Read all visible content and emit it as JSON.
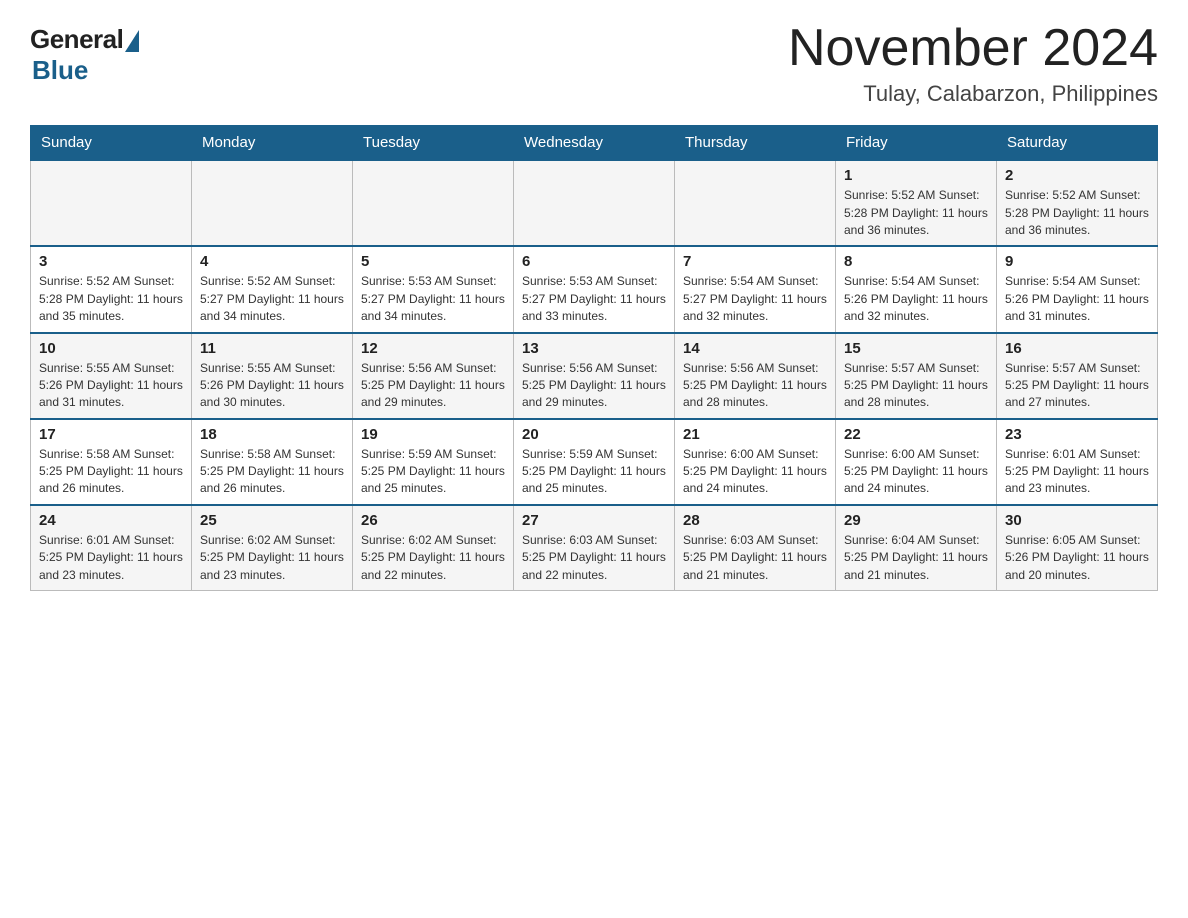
{
  "logo": {
    "general": "General",
    "blue": "Blue"
  },
  "title": "November 2024",
  "subtitle": "Tulay, Calabarzon, Philippines",
  "days_of_week": [
    "Sunday",
    "Monday",
    "Tuesday",
    "Wednesday",
    "Thursday",
    "Friday",
    "Saturday"
  ],
  "weeks": [
    {
      "days": [
        {
          "num": "",
          "info": ""
        },
        {
          "num": "",
          "info": ""
        },
        {
          "num": "",
          "info": ""
        },
        {
          "num": "",
          "info": ""
        },
        {
          "num": "",
          "info": ""
        },
        {
          "num": "1",
          "info": "Sunrise: 5:52 AM\nSunset: 5:28 PM\nDaylight: 11 hours and 36 minutes."
        },
        {
          "num": "2",
          "info": "Sunrise: 5:52 AM\nSunset: 5:28 PM\nDaylight: 11 hours and 36 minutes."
        }
      ]
    },
    {
      "days": [
        {
          "num": "3",
          "info": "Sunrise: 5:52 AM\nSunset: 5:28 PM\nDaylight: 11 hours and 35 minutes."
        },
        {
          "num": "4",
          "info": "Sunrise: 5:52 AM\nSunset: 5:27 PM\nDaylight: 11 hours and 34 minutes."
        },
        {
          "num": "5",
          "info": "Sunrise: 5:53 AM\nSunset: 5:27 PM\nDaylight: 11 hours and 34 minutes."
        },
        {
          "num": "6",
          "info": "Sunrise: 5:53 AM\nSunset: 5:27 PM\nDaylight: 11 hours and 33 minutes."
        },
        {
          "num": "7",
          "info": "Sunrise: 5:54 AM\nSunset: 5:27 PM\nDaylight: 11 hours and 32 minutes."
        },
        {
          "num": "8",
          "info": "Sunrise: 5:54 AM\nSunset: 5:26 PM\nDaylight: 11 hours and 32 minutes."
        },
        {
          "num": "9",
          "info": "Sunrise: 5:54 AM\nSunset: 5:26 PM\nDaylight: 11 hours and 31 minutes."
        }
      ]
    },
    {
      "days": [
        {
          "num": "10",
          "info": "Sunrise: 5:55 AM\nSunset: 5:26 PM\nDaylight: 11 hours and 31 minutes."
        },
        {
          "num": "11",
          "info": "Sunrise: 5:55 AM\nSunset: 5:26 PM\nDaylight: 11 hours and 30 minutes."
        },
        {
          "num": "12",
          "info": "Sunrise: 5:56 AM\nSunset: 5:25 PM\nDaylight: 11 hours and 29 minutes."
        },
        {
          "num": "13",
          "info": "Sunrise: 5:56 AM\nSunset: 5:25 PM\nDaylight: 11 hours and 29 minutes."
        },
        {
          "num": "14",
          "info": "Sunrise: 5:56 AM\nSunset: 5:25 PM\nDaylight: 11 hours and 28 minutes."
        },
        {
          "num": "15",
          "info": "Sunrise: 5:57 AM\nSunset: 5:25 PM\nDaylight: 11 hours and 28 minutes."
        },
        {
          "num": "16",
          "info": "Sunrise: 5:57 AM\nSunset: 5:25 PM\nDaylight: 11 hours and 27 minutes."
        }
      ]
    },
    {
      "days": [
        {
          "num": "17",
          "info": "Sunrise: 5:58 AM\nSunset: 5:25 PM\nDaylight: 11 hours and 26 minutes."
        },
        {
          "num": "18",
          "info": "Sunrise: 5:58 AM\nSunset: 5:25 PM\nDaylight: 11 hours and 26 minutes."
        },
        {
          "num": "19",
          "info": "Sunrise: 5:59 AM\nSunset: 5:25 PM\nDaylight: 11 hours and 25 minutes."
        },
        {
          "num": "20",
          "info": "Sunrise: 5:59 AM\nSunset: 5:25 PM\nDaylight: 11 hours and 25 minutes."
        },
        {
          "num": "21",
          "info": "Sunrise: 6:00 AM\nSunset: 5:25 PM\nDaylight: 11 hours and 24 minutes."
        },
        {
          "num": "22",
          "info": "Sunrise: 6:00 AM\nSunset: 5:25 PM\nDaylight: 11 hours and 24 minutes."
        },
        {
          "num": "23",
          "info": "Sunrise: 6:01 AM\nSunset: 5:25 PM\nDaylight: 11 hours and 23 minutes."
        }
      ]
    },
    {
      "days": [
        {
          "num": "24",
          "info": "Sunrise: 6:01 AM\nSunset: 5:25 PM\nDaylight: 11 hours and 23 minutes."
        },
        {
          "num": "25",
          "info": "Sunrise: 6:02 AM\nSunset: 5:25 PM\nDaylight: 11 hours and 23 minutes."
        },
        {
          "num": "26",
          "info": "Sunrise: 6:02 AM\nSunset: 5:25 PM\nDaylight: 11 hours and 22 minutes."
        },
        {
          "num": "27",
          "info": "Sunrise: 6:03 AM\nSunset: 5:25 PM\nDaylight: 11 hours and 22 minutes."
        },
        {
          "num": "28",
          "info": "Sunrise: 6:03 AM\nSunset: 5:25 PM\nDaylight: 11 hours and 21 minutes."
        },
        {
          "num": "29",
          "info": "Sunrise: 6:04 AM\nSunset: 5:25 PM\nDaylight: 11 hours and 21 minutes."
        },
        {
          "num": "30",
          "info": "Sunrise: 6:05 AM\nSunset: 5:26 PM\nDaylight: 11 hours and 20 minutes."
        }
      ]
    }
  ]
}
